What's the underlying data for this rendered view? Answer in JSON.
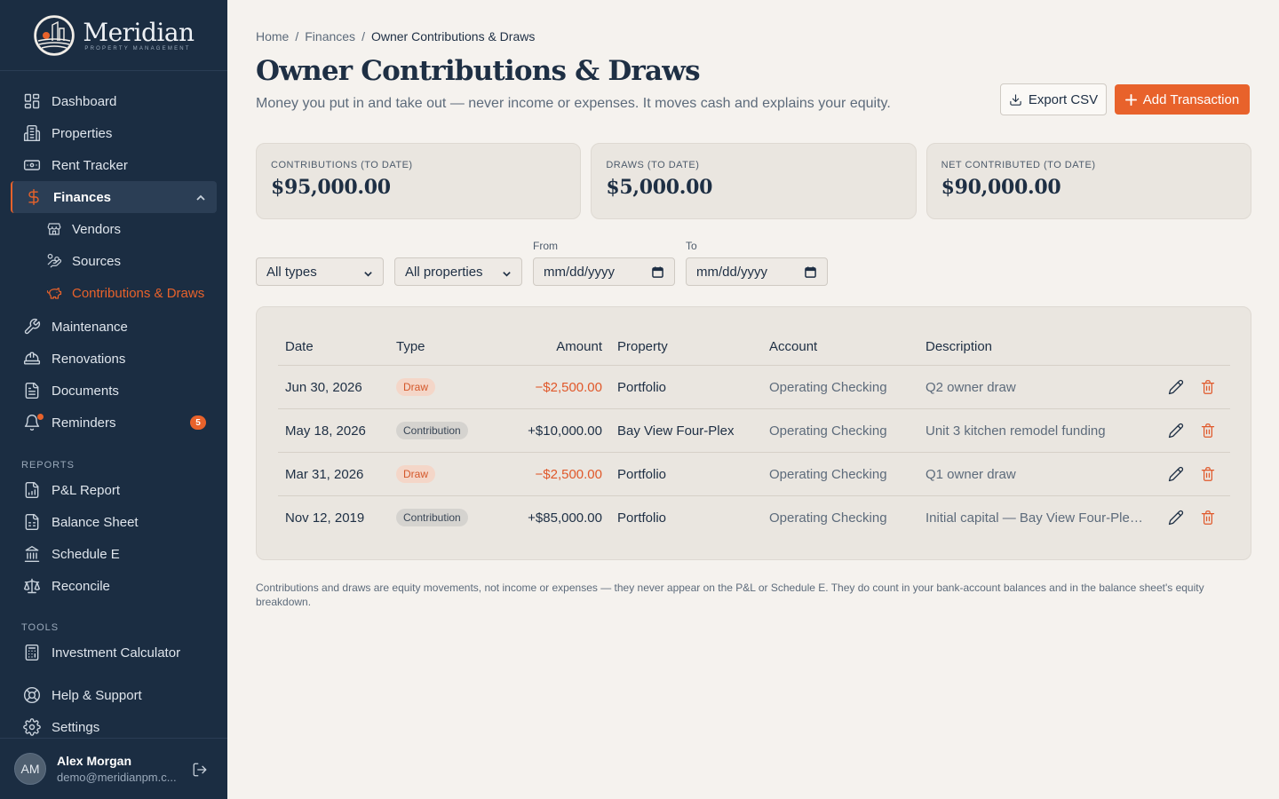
{
  "brand": {
    "name": "Meridian",
    "tagline": "PROPERTY MANAGEMENT"
  },
  "sidebar": {
    "items": [
      {
        "label": "Dashboard",
        "icon": "dashboard-icon"
      },
      {
        "label": "Properties",
        "icon": "building-icon"
      },
      {
        "label": "Rent Tracker",
        "icon": "banknote-icon"
      },
      {
        "label": "Finances",
        "icon": "dollar-icon",
        "active": true,
        "expanded": true
      },
      {
        "label": "Maintenance",
        "icon": "wrench-icon"
      },
      {
        "label": "Renovations",
        "icon": "hardhat-icon"
      },
      {
        "label": "Documents",
        "icon": "document-icon"
      },
      {
        "label": "Reminders",
        "icon": "bell-icon",
        "badge": "5"
      }
    ],
    "finances_children": [
      {
        "label": "Vendors",
        "icon": "store-icon"
      },
      {
        "label": "Sources",
        "icon": "hand-coins-icon"
      },
      {
        "label": "Contributions & Draws",
        "icon": "piggy-bank-icon",
        "current": true
      }
    ],
    "reports_label": "REPORTS",
    "reports": [
      {
        "label": "P&L Report",
        "icon": "chart-file-icon"
      },
      {
        "label": "Balance Sheet",
        "icon": "spreadsheet-icon"
      },
      {
        "label": "Schedule E",
        "icon": "bank-icon"
      },
      {
        "label": "Reconcile",
        "icon": "scale-icon"
      }
    ],
    "tools_label": "TOOLS",
    "tools": [
      {
        "label": "Investment Calculator",
        "icon": "calculator-icon"
      }
    ],
    "help_label": "Help & Support",
    "settings_label": "Settings"
  },
  "user": {
    "initials": "AM",
    "name": "Alex Morgan",
    "email": "demo@meridianpm.c..."
  },
  "breadcrumb": {
    "home": "Home",
    "sep": "/",
    "section": "Finances",
    "current": "Owner Contributions & Draws"
  },
  "page": {
    "title": "Owner Contributions & Draws",
    "subtitle": "Money you put in and take out — never income or expenses. It moves cash and explains your equity."
  },
  "actions": {
    "export": "Export CSV",
    "add": "Add Transaction"
  },
  "summary": [
    {
      "label": "CONTRIBUTIONS (TO DATE)",
      "value": "$95,000.00"
    },
    {
      "label": "DRAWS (TO DATE)",
      "value": "$5,000.00"
    },
    {
      "label": "NET CONTRIBUTED (TO DATE)",
      "value": "$90,000.00"
    }
  ],
  "filters": {
    "type_value": "All types",
    "property_value": "All properties",
    "from_label": "From",
    "to_label": "To",
    "from_placeholder": "mm/dd/yyyy",
    "to_placeholder": "mm/dd/yyyy"
  },
  "table": {
    "columns": [
      "Date",
      "Type",
      "Amount",
      "Property",
      "Account",
      "Description"
    ],
    "rows": [
      {
        "date": "Jun 30, 2026",
        "type": "Draw",
        "amount": "−$2,500.00",
        "property": "Portfolio",
        "account": "Operating Checking",
        "description": "Q2 owner draw"
      },
      {
        "date": "May 18, 2026",
        "type": "Contribution",
        "amount": "+$10,000.00",
        "property": "Bay View Four-Plex",
        "account": "Operating Checking",
        "description": "Unit 3 kitchen remodel funding"
      },
      {
        "date": "Mar 31, 2026",
        "type": "Draw",
        "amount": "−$2,500.00",
        "property": "Portfolio",
        "account": "Operating Checking",
        "description": "Q1 owner draw"
      },
      {
        "date": "Nov 12, 2019",
        "type": "Contribution",
        "amount": "+$85,000.00",
        "property": "Portfolio",
        "account": "Operating Checking",
        "description": "Initial capital — Bay View Four-Plex ..."
      }
    ]
  },
  "footnote": "Contributions and draws are equity movements, not income or expenses — they never appear on the P&L or Schedule E. They do count in your bank-account balances and in the balance sheet's equity breakdown.",
  "colors": {
    "sidebar_bg": "#1b2d42",
    "accent": "#e8622b",
    "page_bg": "#f5f2ee",
    "card_bg": "#eae6e0"
  }
}
